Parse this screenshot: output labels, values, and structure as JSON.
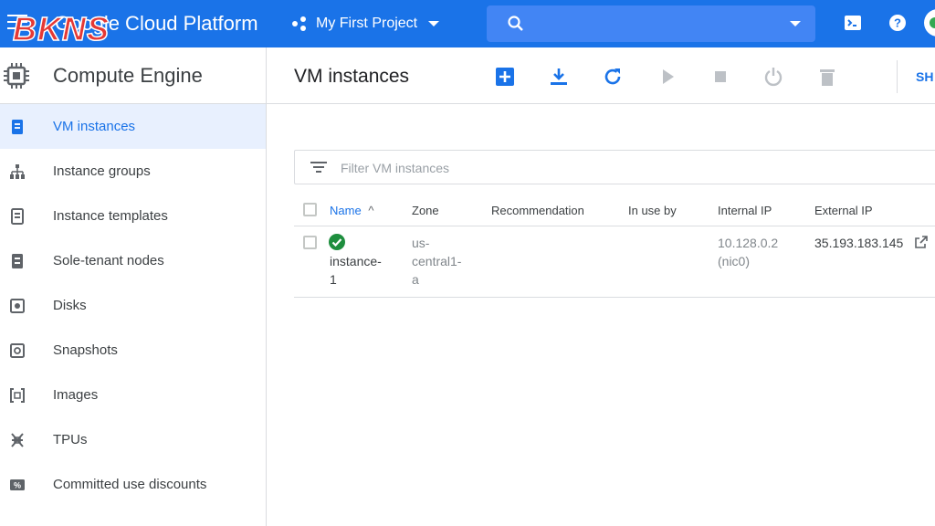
{
  "topbar": {
    "platform_title": "Google Cloud Platform",
    "logo_text": "BKNS",
    "project": "My First Project",
    "search_placeholder": "",
    "brand_color": "#1a73e8",
    "icons": [
      "menu-icon",
      "project-dots-icon",
      "search-icon",
      "cloud-shell-icon",
      "help-icon",
      "account-avatar"
    ]
  },
  "sidebar": {
    "title": "Compute Engine",
    "items": [
      {
        "label": "VM instances",
        "icon": "vm-instances-icon",
        "active": true
      },
      {
        "label": "Instance groups",
        "icon": "instance-groups-icon"
      },
      {
        "label": "Instance templates",
        "icon": "instance-templates-icon"
      },
      {
        "label": "Sole-tenant nodes",
        "icon": "sole-tenant-icon"
      },
      {
        "label": "Disks",
        "icon": "disk-icon"
      },
      {
        "label": "Snapshots",
        "icon": "snapshot-icon"
      },
      {
        "label": "Images",
        "icon": "images-icon"
      },
      {
        "label": "TPUs",
        "icon": "tpu-icon"
      },
      {
        "label": "Committed use discounts",
        "icon": "discount-icon"
      }
    ]
  },
  "main": {
    "page_title": "VM instances",
    "toolbar": {
      "buttons": [
        "create-instance",
        "import-vm",
        "refresh",
        "start",
        "stop",
        "reset",
        "delete"
      ],
      "show_label": "SH"
    },
    "filter": {
      "placeholder": "Filter VM instances"
    },
    "table": {
      "headers": {
        "name": "Name",
        "sort_arrow": "^",
        "zone": "Zone",
        "recommendation": "Recommendation",
        "in_use_by": "In use by",
        "internal_ip": "Internal IP",
        "external_ip": "External IP"
      },
      "rows": [
        {
          "status": "running",
          "name_line1": "instance-",
          "name_line2": "1",
          "zone_line1": "us-",
          "zone_line2": "central1-",
          "zone_line3": "a",
          "recommendation": "",
          "in_use_by": "",
          "internal_ip_line1": "10.128.0.2",
          "internal_ip_line2": "(nic0)",
          "external_ip": "35.193.183.145"
        }
      ]
    }
  }
}
